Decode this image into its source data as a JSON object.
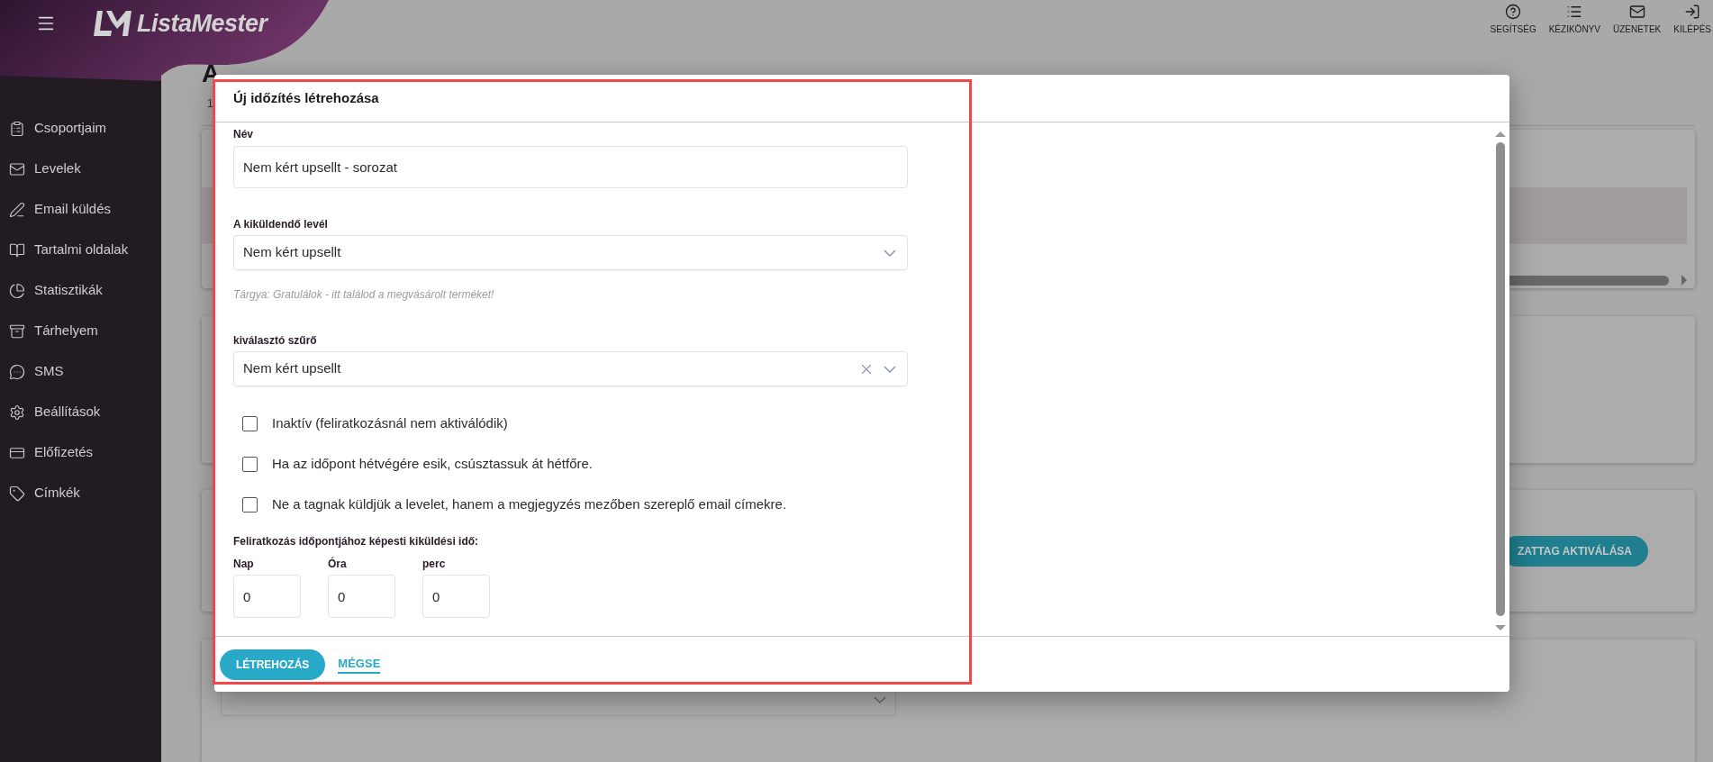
{
  "header": {
    "logo": "ListaMester",
    "actions": [
      {
        "label": "SEGÍTSÉG"
      },
      {
        "label": "KÉZIKÖNYV"
      },
      {
        "label": "ÜZENETEK"
      },
      {
        "label": "KILÉPÉS"
      }
    ]
  },
  "sidebar": {
    "items": [
      {
        "label": "Csoportjaim"
      },
      {
        "label": "Levelek"
      },
      {
        "label": "Email küldés"
      },
      {
        "label": "Tartalmi oldalak"
      },
      {
        "label": "Statisztikák"
      },
      {
        "label": "Tárhelyem"
      },
      {
        "label": "SMS"
      },
      {
        "label": "Beállítások"
      },
      {
        "label": "Előfizetés"
      },
      {
        "label": "Címkék"
      }
    ]
  },
  "page": {
    "title": "A",
    "subtitle": "1",
    "activate_button": "ZATTAG AKTIVÁLÁSA"
  },
  "dialog": {
    "title": "Új időzítés létrehozása",
    "name_field": {
      "label": "Név",
      "value": "Nem kért upsellt - sorozat"
    },
    "letter_select": {
      "label": "A kiküldendő levél",
      "value": "Nem kért upsellt",
      "clearable": false
    },
    "subject_hint": "Tárgya: Gratulálok - itt találod a megvásárolt terméket!",
    "filter_select": {
      "label": "kiválasztó szűrő",
      "value": "Nem kért upsellt",
      "clearable": true
    },
    "options": [
      {
        "label": "Inaktív (feliratkozásnál nem aktiválódik)",
        "checked": false
      },
      {
        "label": "Ha az időpont hétvégére esik, csúsztassuk át hétfőre.",
        "checked": false
      },
      {
        "label": "Ne a tagnak küldjük a levelet, hanem a megjegyzés mezőben szereplő email címekre.",
        "checked": false
      }
    ],
    "offset": {
      "label": "Feliratkozás időpontjához képesti kiküldési idő:",
      "fields": [
        {
          "label": "Nap",
          "value": "0"
        },
        {
          "label": "Óra",
          "value": "0"
        },
        {
          "label": "perc",
          "value": "0"
        }
      ]
    },
    "buttons": {
      "primary": "LÉTREHOZÁS",
      "cancel": "MÉGSE"
    }
  }
}
